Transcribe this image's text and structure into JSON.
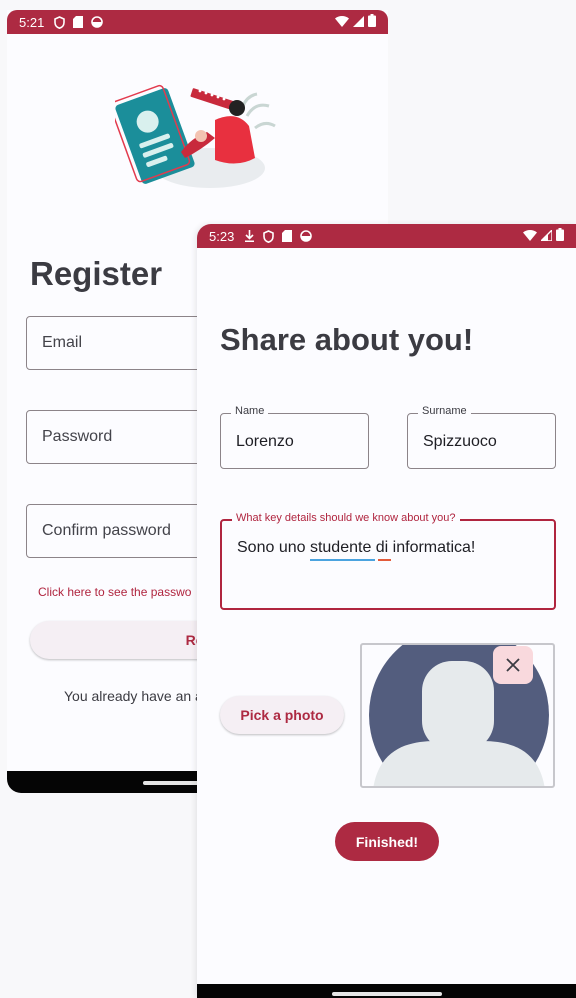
{
  "back_screen": {
    "status_bar": {
      "time": "5:21",
      "icons": [
        "shield-icon",
        "sim-icon",
        "circle-icon"
      ],
      "right_icons": [
        "wifi-icon",
        "signal-icon",
        "battery-icon"
      ]
    },
    "title": "Register",
    "email_placeholder": "Email",
    "password_placeholder": "Password",
    "confirm_placeholder": "Confirm password",
    "hint_link": "Click here to see the passwo",
    "register_button": "Regi",
    "login_text": "You already have an a"
  },
  "front_screen": {
    "status_bar": {
      "time": "5:23",
      "icons": [
        "download-icon",
        "shield-icon",
        "sim-icon",
        "circle-icon"
      ],
      "right_icons": [
        "wifi-icon",
        "signal-icon",
        "battery-icon"
      ]
    },
    "title": "Share about you!",
    "name_field": {
      "label": "Name",
      "value": "Lorenzo"
    },
    "surname_field": {
      "label": "Surname",
      "value": "Spizzuoco"
    },
    "details_field": {
      "label": "What key details should we know about you?",
      "value": "Sono uno studente di informatica!",
      "accent": "#b0253f"
    },
    "pick_photo_button": "Pick a photo",
    "finished_button": "Finished!",
    "photo": {
      "alt": "avatar-placeholder",
      "circle_color": "#535d7e",
      "figure_color": "#e6eaec"
    }
  },
  "colors": {
    "brand": "#ad2a42",
    "error": "#b0253f",
    "title": "#3b3b42"
  }
}
